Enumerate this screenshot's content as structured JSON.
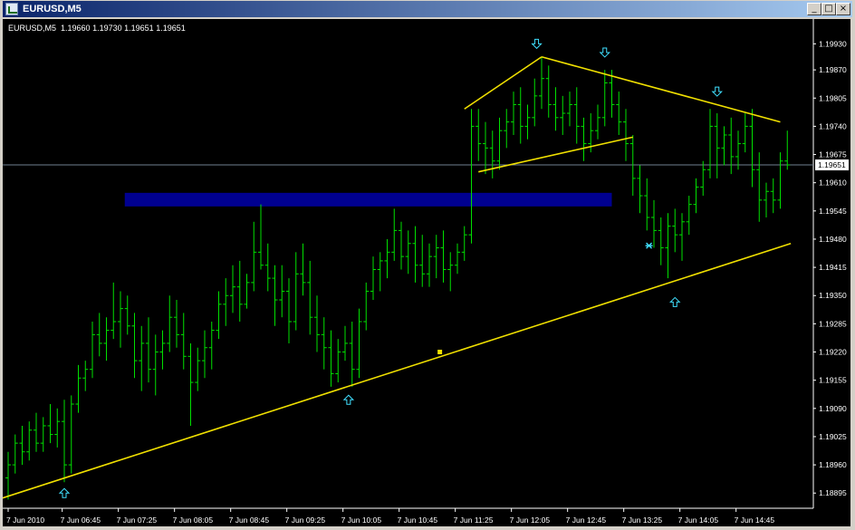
{
  "window": {
    "title": "EURUSD,M5",
    "buttons": {
      "minimize": "_",
      "maximize": "□",
      "close": "×"
    }
  },
  "chart_header": {
    "symbol": "EURUSD,M5",
    "open": "1.19660",
    "high": "1.19730",
    "low": "1.19651",
    "close": "1.19651"
  },
  "colors": {
    "background": "#000000",
    "bars": "#00e000",
    "trendlines": "#f0e000",
    "arrows": "#40e0ff",
    "zone": "#000090",
    "bid_line": "#708090"
  },
  "chart_data": {
    "type": "bar",
    "symbol": "EURUSD",
    "timeframe": "M5",
    "ylim": [
      1.1886,
      1.1996
    ],
    "y_ticks": [
      "1.19930",
      "1.19870",
      "1.19805",
      "1.19740",
      "1.19675",
      "1.19610",
      "1.19545",
      "1.19480",
      "1.19415",
      "1.19350",
      "1.19285",
      "1.19220",
      "1.19155",
      "1.19090",
      "1.19025",
      "1.18960",
      "1.18895"
    ],
    "x_ticks": [
      "7 Jun 2010",
      "7 Jun 06:45",
      "7 Jun 07:25",
      "7 Jun 08:05",
      "7 Jun 08:45",
      "7 Jun 09:25",
      "7 Jun 10:05",
      "7 Jun 10:45",
      "7 Jun 11:25",
      "7 Jun 12:05",
      "7 Jun 12:45",
      "7 Jun 13:25",
      "7 Jun 14:05",
      "7 Jun 14:45"
    ],
    "current_price": "1.19651",
    "bars": [
      [
        1.1893,
        1.1899,
        1.1888,
        1.1896
      ],
      [
        1.1896,
        1.1903,
        1.1894,
        1.1901
      ],
      [
        1.1901,
        1.1905,
        1.1896,
        1.1899
      ],
      [
        1.1899,
        1.1906,
        1.1897,
        1.1904
      ],
      [
        1.1904,
        1.1908,
        1.1899,
        1.1901
      ],
      [
        1.1901,
        1.1907,
        1.1899,
        1.1905
      ],
      [
        1.1905,
        1.191,
        1.1901,
        1.1903
      ],
      [
        1.1903,
        1.1909,
        1.19,
        1.1906
      ],
      [
        1.1906,
        1.1911,
        1.1892,
        1.1896
      ],
      [
        1.1896,
        1.1912,
        1.1894,
        1.191
      ],
      [
        1.191,
        1.1919,
        1.1908,
        1.1916
      ],
      [
        1.1916,
        1.192,
        1.1913,
        1.1918
      ],
      [
        1.1918,
        1.1929,
        1.1916,
        1.1926
      ],
      [
        1.1926,
        1.1931,
        1.1921,
        1.1924
      ],
      [
        1.1924,
        1.193,
        1.192,
        1.1927
      ],
      [
        1.1927,
        1.1938,
        1.1925,
        1.1929
      ],
      [
        1.1929,
        1.1936,
        1.1923,
        1.1932
      ],
      [
        1.1932,
        1.1935,
        1.1926,
        1.1928
      ],
      [
        1.1928,
        1.1931,
        1.1916,
        1.192
      ],
      [
        1.192,
        1.1928,
        1.1913,
        1.1924
      ],
      [
        1.1924,
        1.193,
        1.1915,
        1.1918
      ],
      [
        1.1918,
        1.1926,
        1.1912,
        1.1922
      ],
      [
        1.1922,
        1.1927,
        1.1918,
        1.1924
      ],
      [
        1.1924,
        1.1935,
        1.1922,
        1.193
      ],
      [
        1.193,
        1.1934,
        1.1923,
        1.1926
      ],
      [
        1.1926,
        1.1931,
        1.1918,
        1.1921
      ],
      [
        1.1921,
        1.1924,
        1.1905,
        1.1915
      ],
      [
        1.1915,
        1.1923,
        1.1913,
        1.192
      ],
      [
        1.192,
        1.1927,
        1.1916,
        1.1923
      ],
      [
        1.1923,
        1.1929,
        1.1918,
        1.1927
      ],
      [
        1.1927,
        1.1936,
        1.1925,
        1.1933
      ],
      [
        1.1933,
        1.1939,
        1.1928,
        1.1935
      ],
      [
        1.1935,
        1.1942,
        1.1931,
        1.1937
      ],
      [
        1.1937,
        1.1943,
        1.1929,
        1.1933
      ],
      [
        1.1933,
        1.194,
        1.1932,
        1.1938
      ],
      [
        1.1938,
        1.1952,
        1.1936,
        1.1945
      ],
      [
        1.1945,
        1.1956,
        1.1941,
        1.1942
      ],
      [
        1.1942,
        1.1947,
        1.1936,
        1.1939
      ],
      [
        1.1939,
        1.1942,
        1.1928,
        1.1934
      ],
      [
        1.1934,
        1.1942,
        1.193,
        1.1936
      ],
      [
        1.1936,
        1.1939,
        1.1924,
        1.1929
      ],
      [
        1.1929,
        1.1945,
        1.1927,
        1.194
      ],
      [
        1.194,
        1.1947,
        1.1935,
        1.1938
      ],
      [
        1.1938,
        1.1943,
        1.1926,
        1.193
      ],
      [
        1.193,
        1.1935,
        1.1922,
        1.1926
      ],
      [
        1.1926,
        1.193,
        1.1918,
        1.1923
      ],
      [
        1.1923,
        1.1927,
        1.1914,
        1.1917
      ],
      [
        1.1917,
        1.1925,
        1.1915,
        1.1922
      ],
      [
        1.1922,
        1.1928,
        1.192,
        1.1924
      ],
      [
        1.1924,
        1.1929,
        1.1914,
        1.1918
      ],
      [
        1.1918,
        1.1932,
        1.1916,
        1.1929
      ],
      [
        1.1929,
        1.1938,
        1.1927,
        1.1936
      ],
      [
        1.1936,
        1.1944,
        1.1934,
        1.1941
      ],
      [
        1.1941,
        1.1945,
        1.1936,
        1.1943
      ],
      [
        1.1943,
        1.1948,
        1.1939,
        1.1945
      ],
      [
        1.1945,
        1.1955,
        1.1943,
        1.195
      ],
      [
        1.195,
        1.1952,
        1.1941,
        1.1944
      ],
      [
        1.1944,
        1.195,
        1.194,
        1.1947
      ],
      [
        1.1947,
        1.1951,
        1.1938,
        1.1942
      ],
      [
        1.1942,
        1.1949,
        1.1937,
        1.194
      ],
      [
        1.194,
        1.1947,
        1.1937,
        1.1944
      ],
      [
        1.1944,
        1.1949,
        1.1939,
        1.1946
      ],
      [
        1.1946,
        1.195,
        1.1938,
        1.1941
      ],
      [
        1.1941,
        1.1945,
        1.1936,
        1.1942
      ],
      [
        1.1942,
        1.1947,
        1.194,
        1.1945
      ],
      [
        1.1945,
        1.1951,
        1.1943,
        1.1949
      ],
      [
        1.1949,
        1.1978,
        1.1947,
        1.1974
      ],
      [
        1.1974,
        1.1978,
        1.1966,
        1.197
      ],
      [
        1.197,
        1.1975,
        1.1963,
        1.1969
      ],
      [
        1.1969,
        1.1973,
        1.1962,
        1.1966
      ],
      [
        1.1966,
        1.1976,
        1.1964,
        1.1973
      ],
      [
        1.1973,
        1.1978,
        1.1969,
        1.1975
      ],
      [
        1.1975,
        1.1982,
        1.1972,
        1.1979
      ],
      [
        1.1979,
        1.1983,
        1.197,
        1.1974
      ],
      [
        1.1974,
        1.1979,
        1.1971,
        1.1976
      ],
      [
        1.1976,
        1.1985,
        1.1974,
        1.1981
      ],
      [
        1.1981,
        1.199,
        1.1978,
        1.1985
      ],
      [
        1.1985,
        1.1988,
        1.1976,
        1.1979
      ],
      [
        1.1979,
        1.1983,
        1.1973,
        1.1976
      ],
      [
        1.1976,
        1.1981,
        1.1972,
        1.1977
      ],
      [
        1.1977,
        1.1982,
        1.1974,
        1.1979
      ],
      [
        1.1979,
        1.1983,
        1.197,
        1.1974
      ],
      [
        1.1974,
        1.1976,
        1.1966,
        1.197
      ],
      [
        1.197,
        1.1977,
        1.1968,
        1.1973
      ],
      [
        1.1973,
        1.1979,
        1.1971,
        1.1976
      ],
      [
        1.1976,
        1.1987,
        1.1974,
        1.1984
      ],
      [
        1.1984,
        1.1987,
        1.1976,
        1.1979
      ],
      [
        1.1979,
        1.1982,
        1.1972,
        1.1975
      ],
      [
        1.1975,
        1.1978,
        1.1966,
        1.197
      ],
      [
        1.197,
        1.1972,
        1.1958,
        1.1962
      ],
      [
        1.1962,
        1.1965,
        1.1954,
        1.1958
      ],
      [
        1.1958,
        1.1962,
        1.195,
        1.1953
      ],
      [
        1.1953,
        1.1957,
        1.1946,
        1.195
      ],
      [
        1.195,
        1.1953,
        1.1942,
        1.1946
      ],
      [
        1.1946,
        1.1954,
        1.1939,
        1.1951
      ],
      [
        1.1951,
        1.1955,
        1.1945,
        1.1949
      ],
      [
        1.1949,
        1.1954,
        1.1943,
        1.1952
      ],
      [
        1.1952,
        1.1958,
        1.1949,
        1.1956
      ],
      [
        1.1956,
        1.1962,
        1.1954,
        1.196
      ],
      [
        1.196,
        1.1966,
        1.1958,
        1.1964
      ],
      [
        1.1964,
        1.1978,
        1.1962,
        1.1974
      ],
      [
        1.1974,
        1.1977,
        1.1962,
        1.1969
      ],
      [
        1.1969,
        1.1974,
        1.1965,
        1.1972
      ],
      [
        1.1972,
        1.1976,
        1.1963,
        1.1967
      ],
      [
        1.1967,
        1.1973,
        1.1964,
        1.197
      ],
      [
        1.197,
        1.1977,
        1.1968,
        1.1974
      ],
      [
        1.1974,
        1.1978,
        1.196,
        1.1964
      ],
      [
        1.1964,
        1.1968,
        1.1952,
        1.1957
      ],
      [
        1.1957,
        1.1961,
        1.1953,
        1.1959
      ],
      [
        1.1959,
        1.1962,
        1.1954,
        1.1957
      ],
      [
        1.1957,
        1.1968,
        1.1955,
        1.1966
      ],
      [
        1.1966,
        1.1973,
        1.1964,
        1.19651
      ]
    ],
    "zone": {
      "price_top": 1.1957,
      "price_bottom": 1.19545,
      "bar_start": 17,
      "bar_end": 86
    },
    "trendlines": [
      {
        "bar1": -1.5,
        "p1": 1.1888,
        "bar2": 111.5,
        "p2": 1.1947
      },
      {
        "bar1": 65,
        "p1": 1.1978,
        "bar2": 76,
        "p2": 1.199
      },
      {
        "bar1": 76,
        "p1": 1.199,
        "bar2": 110,
        "p2": 1.1975
      },
      {
        "bar1": 67,
        "p1": 1.19635,
        "bar2": 89,
        "p2": 1.19715
      }
    ],
    "arrows": [
      {
        "dir": "up",
        "bar": 8,
        "price": 1.18895
      },
      {
        "dir": "up",
        "bar": 48.5,
        "price": 1.1911
      },
      {
        "dir": "down",
        "bar": 75.3,
        "price": 1.1993
      },
      {
        "dir": "down",
        "bar": 85,
        "price": 1.1991
      },
      {
        "dir": "down",
        "bar": 101,
        "price": 1.1982
      },
      {
        "dir": "up",
        "bar": 95,
        "price": 1.19335
      }
    ],
    "markers": [
      {
        "shape": "square",
        "color": "#f0e000",
        "bar": 61.5,
        "price": 1.1922
      },
      {
        "shape": "star",
        "color": "#40e0ff",
        "bar": 91.3,
        "price": 1.19465
      }
    ]
  }
}
